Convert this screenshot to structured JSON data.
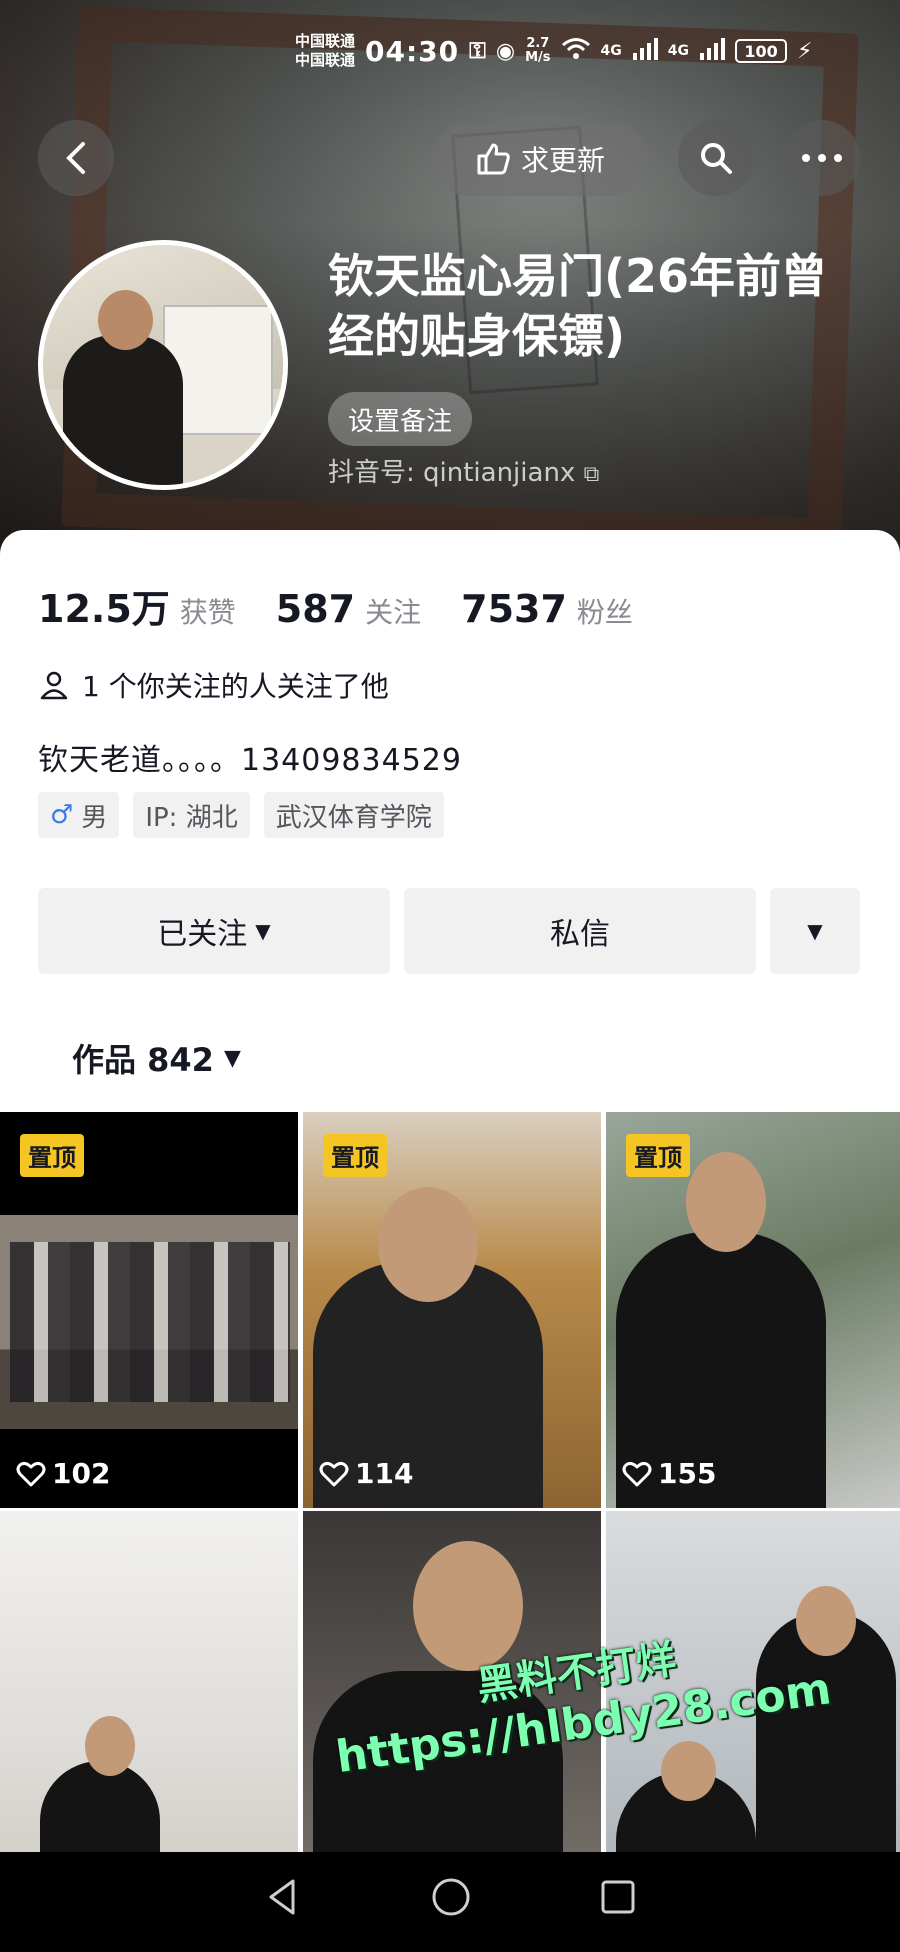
{
  "status_bar": {
    "carrier1": "中国联通",
    "carrier2": "中国联通",
    "time": "04:30",
    "speed_top": "2.7",
    "speed_bottom": "M/s",
    "net1": "4G",
    "net2": "4G",
    "battery": "100"
  },
  "header": {
    "update_label": "求更新",
    "name": "钦天监心易门(26年前曾经的贴身保镖)",
    "remark_label": "设置备注",
    "douyin_id_label": "抖音号: qintianjianx"
  },
  "stats": [
    {
      "num": "12.5万",
      "label": "获赞"
    },
    {
      "num": "587",
      "label": "关注"
    },
    {
      "num": "7537",
      "label": "粉丝"
    }
  ],
  "mutual_text": "1 个你关注的人关注了他",
  "bio": "钦天老道。。。。13409834529",
  "tags": {
    "gender_symbol": "♂",
    "gender": "男",
    "ip": "IP: 湖北",
    "school": "武汉体育学院"
  },
  "actions": {
    "followed_label": "已关注",
    "message_label": "私信"
  },
  "works_tab_label": "作品 842",
  "videos": [
    {
      "pinned": "置顶",
      "likes": "102"
    },
    {
      "pinned": "置顶",
      "likes": "114"
    },
    {
      "pinned": "置顶",
      "likes": "155"
    },
    {
      "pinned": "",
      "likes": ""
    },
    {
      "pinned": "",
      "likes": ""
    },
    {
      "pinned": "",
      "likes": ""
    }
  ],
  "watermark": {
    "line1": "黑料不打烊",
    "line2": "https://hlbdy28.com"
  },
  "colors": {
    "accent_pin": "#f5c523",
    "text_primary": "#161823",
    "text_secondary": "#8a8b91",
    "button_bg": "#f1f1f2"
  }
}
